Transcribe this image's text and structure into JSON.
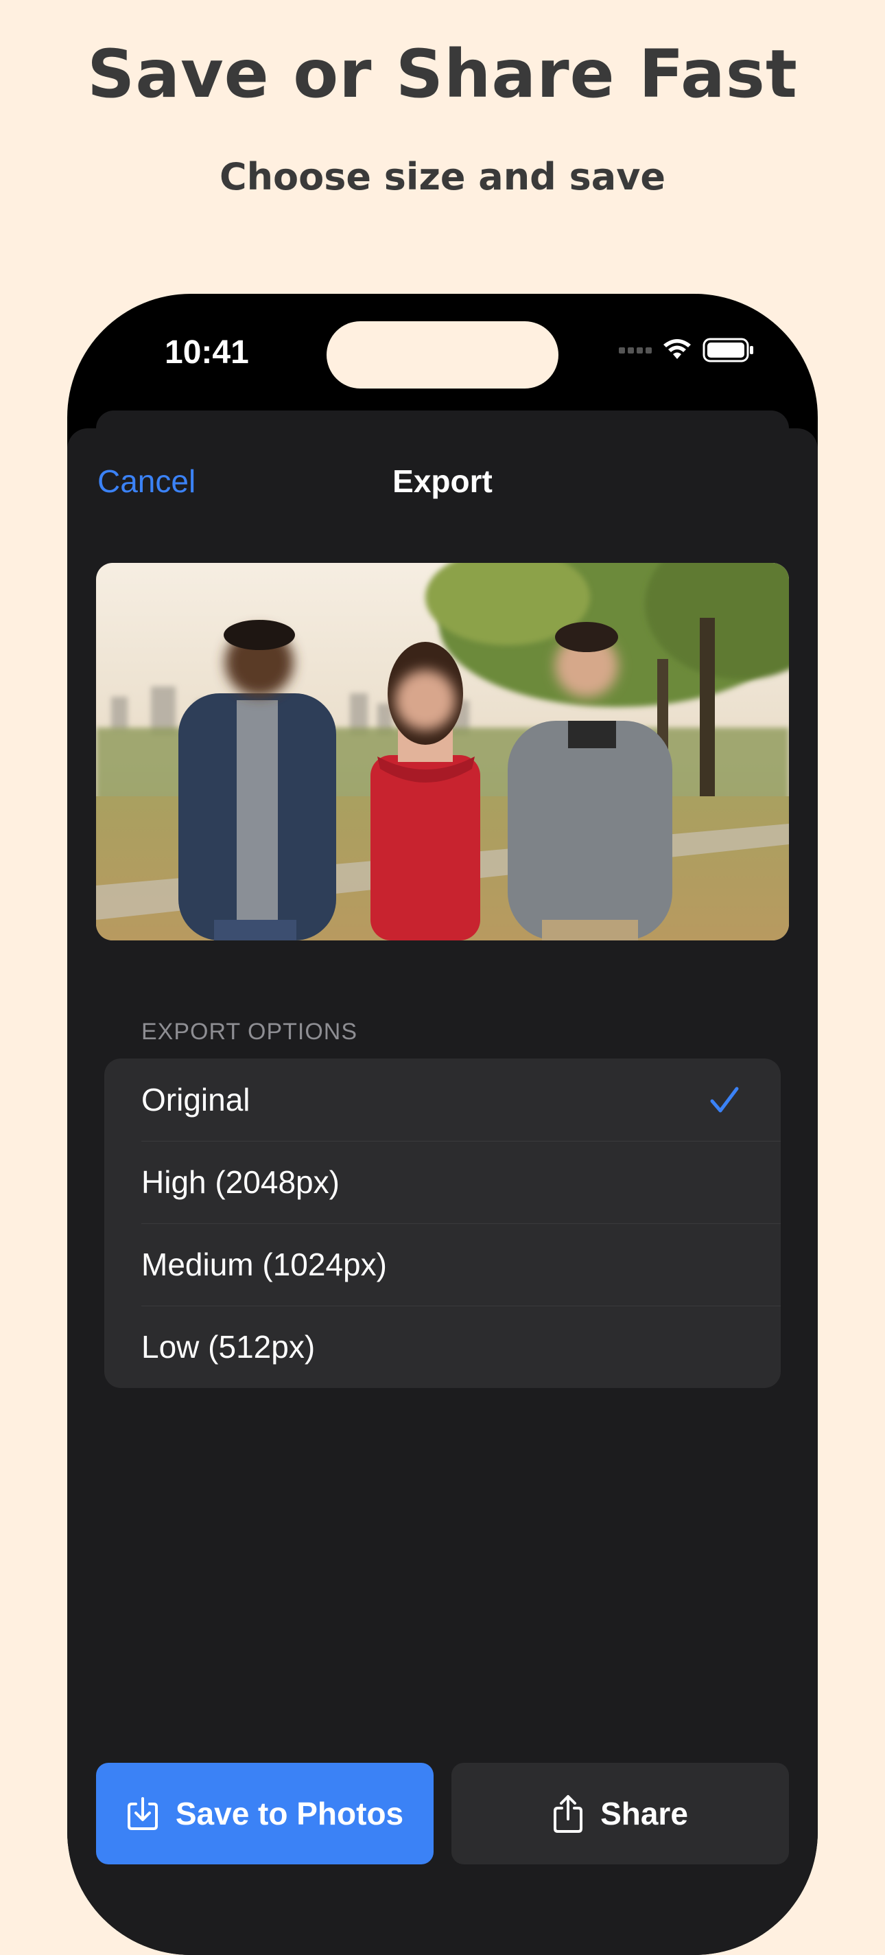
{
  "promo": {
    "headline": "Save or Share Fast",
    "subhead": "Choose size and save"
  },
  "status_bar": {
    "time": "10:41",
    "icons": [
      "cellular-signal-icon",
      "wifi-icon",
      "battery-icon"
    ]
  },
  "nav": {
    "cancel_label": "Cancel",
    "title": "Export"
  },
  "export": {
    "section_label": "EXPORT OPTIONS",
    "options": [
      {
        "label": "Original",
        "selected": true
      },
      {
        "label": "High (2048px)",
        "selected": false
      },
      {
        "label": "Medium (1024px)",
        "selected": false
      },
      {
        "label": "Low (512px)",
        "selected": false
      }
    ]
  },
  "actions": {
    "save_label": "Save to Photos",
    "share_label": "Share"
  },
  "colors": {
    "accent": "#3B82F6",
    "background": "#FFF0E0",
    "sheet": "#1C1C1E",
    "cell": "#2C2C2E"
  }
}
